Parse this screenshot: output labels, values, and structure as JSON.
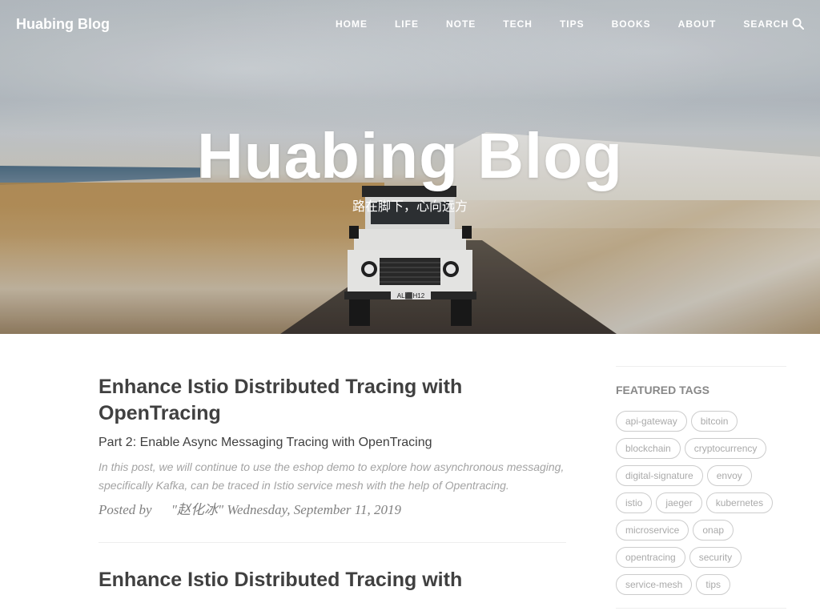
{
  "brand": "Huabing Blog",
  "nav": {
    "items": [
      "HOME",
      "LIFE",
      "NOTE",
      "TECH",
      "TIPS",
      "BOOKS",
      "ABOUT"
    ],
    "search_label": "SEARCH"
  },
  "hero": {
    "title": "Huabing Blog",
    "subtitle": "路在脚下，心向远方",
    "plate": "AL⬛H12"
  },
  "posts": [
    {
      "title": "Enhance Istio Distributed Tracing with OpenTracing",
      "subtitle": "Part 2: Enable Async Messaging Tracing with OpenTracing",
      "excerpt": "In this post, we will continue to use the eshop demo to explore how asynchronous messaging, specifically Kafka, can be traced in Istio service mesh with the help of Opentracing.",
      "posted_by": "Posted by",
      "author": "\"赵化冰\"",
      "date": "Wednesday, September 11, 2019"
    },
    {
      "title": "Enhance Istio Distributed Tracing with"
    }
  ],
  "sidebar": {
    "heading": "FEATURED TAGS",
    "tags": [
      "api-gateway",
      "bitcoin",
      "blockchain",
      "cryptocurrency",
      "digital-signature",
      "envoy",
      "istio",
      "jaeger",
      "kubernetes",
      "microservice",
      "onap",
      "opentracing",
      "security",
      "service-mesh",
      "tips"
    ]
  }
}
